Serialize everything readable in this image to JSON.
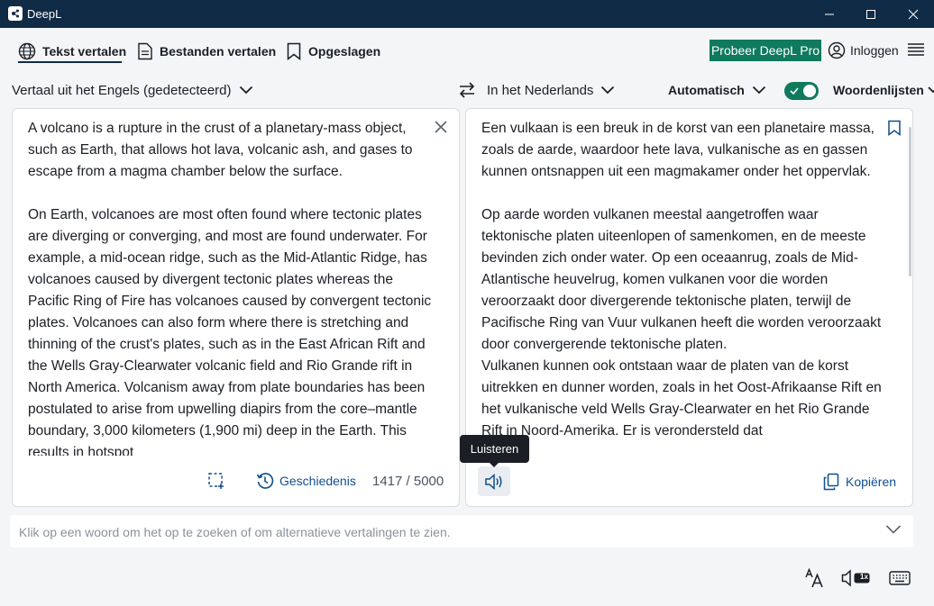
{
  "window": {
    "title": "DeepL"
  },
  "nav": {
    "tabs": [
      {
        "label": "Tekst vertalen",
        "icon": "globe-icon",
        "active": true
      },
      {
        "label": "Bestanden vertalen",
        "icon": "document-icon",
        "active": false
      },
      {
        "label": "Opgeslagen",
        "icon": "bookmark-icon",
        "active": false
      }
    ],
    "pro_button": "Probeer DeepL Pro",
    "login": "Inloggen"
  },
  "language_bar": {
    "source_prefix": "Vertaal uit het ",
    "source_lang": "Engels",
    "source_suffix": " (gedetecteerd)",
    "target_prefix": "In het ",
    "target_lang": "Nederlands",
    "formality": "Automatisch",
    "glossary": "Woordenlijsten",
    "glossary_toggle_on": true
  },
  "source": {
    "paragraphs": [
      "A volcano is a rupture in the crust of a planetary-mass object, such as Earth, that allows hot lava, volcanic ash, and gases to escape from a magma chamber below the surface.",
      "On Earth, volcanoes are most often found where tectonic plates are diverging or converging, and most are found underwater. For example, a mid-ocean ridge, such as the Mid-Atlantic Ridge, has volcanoes caused by divergent tectonic plates whereas the Pacific Ring of Fire has volcanoes caused by convergent tectonic plates. Volcanoes can also form where there is stretching and thinning of the crust's plates, such as in the East African Rift and the Wells Gray-Clearwater volcanic field and Rio Grande rift in North America. Volcanism away from plate boundaries has been postulated to arise from upwelling diapirs from the core–mantle boundary, 3,000 kilometers (1,900 mi) deep in the Earth. This results in hotspot"
    ],
    "history_label": "Geschiedenis",
    "char_count": "1417 / 5000"
  },
  "target": {
    "paragraphs": [
      "Een vulkaan is een breuk in de korst van een planetaire massa, zoals de aarde, waardoor hete lava, vulkanische as en gassen kunnen ontsnappen uit een magmakamer onder het oppervlak.",
      "Op aarde worden vulkanen meestal aangetroffen waar tektonische platen uiteenlopen of samenkomen, en de meeste bevinden zich onder water. Op een oceaanrug, zoals de Mid-Atlantische heuvelrug, komen vulkanen voor die worden veroorzaakt door divergerende tektonische platen, terwijl de Pacifische Ring van Vuur vulkanen heeft die worden veroorzaakt door convergerende tektonische platen.",
      "Vulkanen kunnen ook ontstaan waar de platen van de korst uitrekken en dunner worden, zoals in het Oost-Afrikaanse Rift en het vulkanische veld Wells Gray-Clearwater en het Rio Grande Rift in Noord-Amerika. Er is verondersteld dat"
    ],
    "copy_label": "Kopiëren",
    "listen_tooltip": "Luisteren"
  },
  "lookup": {
    "placeholder": "Klik op een woord om het op te zoeken of om alternatieve vertalingen te zien."
  },
  "footer": {
    "speed_badge": "1x"
  },
  "colors": {
    "titlebar": "#0f2b46",
    "accent_green": "#0f7a5e",
    "link_blue": "#0f4f8f"
  }
}
